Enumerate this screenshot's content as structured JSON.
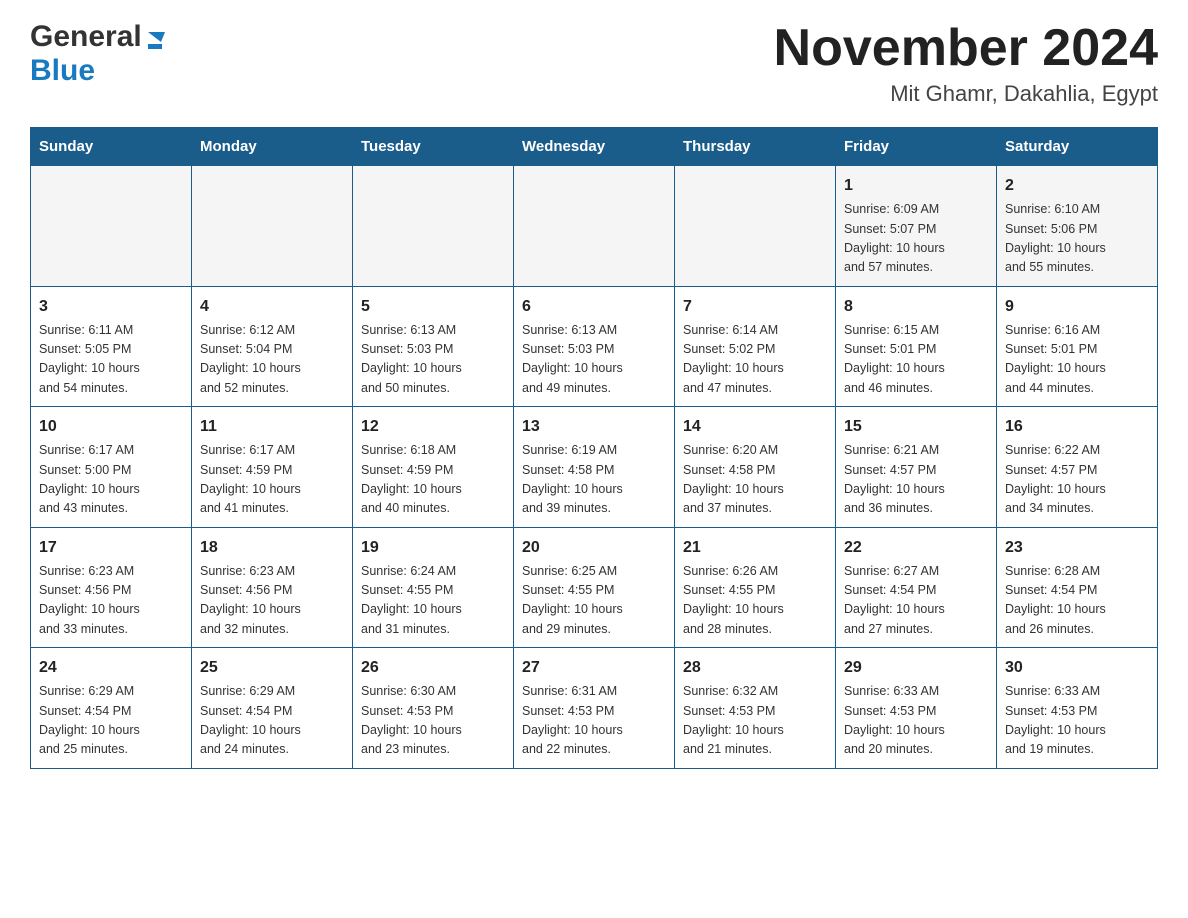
{
  "header": {
    "logo": {
      "general": "General",
      "blue": "Blue",
      "triangle_color": "#1a7abf"
    },
    "title": "November 2024",
    "location": "Mit Ghamr, Dakahlia, Egypt"
  },
  "calendar": {
    "days_of_week": [
      "Sunday",
      "Monday",
      "Tuesday",
      "Wednesday",
      "Thursday",
      "Friday",
      "Saturday"
    ],
    "weeks": [
      {
        "days": [
          {
            "day": "",
            "info": ""
          },
          {
            "day": "",
            "info": ""
          },
          {
            "day": "",
            "info": ""
          },
          {
            "day": "",
            "info": ""
          },
          {
            "day": "",
            "info": ""
          },
          {
            "day": "1",
            "info": "Sunrise: 6:09 AM\nSunset: 5:07 PM\nDaylight: 10 hours\nand 57 minutes."
          },
          {
            "day": "2",
            "info": "Sunrise: 6:10 AM\nSunset: 5:06 PM\nDaylight: 10 hours\nand 55 minutes."
          }
        ]
      },
      {
        "days": [
          {
            "day": "3",
            "info": "Sunrise: 6:11 AM\nSunset: 5:05 PM\nDaylight: 10 hours\nand 54 minutes."
          },
          {
            "day": "4",
            "info": "Sunrise: 6:12 AM\nSunset: 5:04 PM\nDaylight: 10 hours\nand 52 minutes."
          },
          {
            "day": "5",
            "info": "Sunrise: 6:13 AM\nSunset: 5:03 PM\nDaylight: 10 hours\nand 50 minutes."
          },
          {
            "day": "6",
            "info": "Sunrise: 6:13 AM\nSunset: 5:03 PM\nDaylight: 10 hours\nand 49 minutes."
          },
          {
            "day": "7",
            "info": "Sunrise: 6:14 AM\nSunset: 5:02 PM\nDaylight: 10 hours\nand 47 minutes."
          },
          {
            "day": "8",
            "info": "Sunrise: 6:15 AM\nSunset: 5:01 PM\nDaylight: 10 hours\nand 46 minutes."
          },
          {
            "day": "9",
            "info": "Sunrise: 6:16 AM\nSunset: 5:01 PM\nDaylight: 10 hours\nand 44 minutes."
          }
        ]
      },
      {
        "days": [
          {
            "day": "10",
            "info": "Sunrise: 6:17 AM\nSunset: 5:00 PM\nDaylight: 10 hours\nand 43 minutes."
          },
          {
            "day": "11",
            "info": "Sunrise: 6:17 AM\nSunset: 4:59 PM\nDaylight: 10 hours\nand 41 minutes."
          },
          {
            "day": "12",
            "info": "Sunrise: 6:18 AM\nSunset: 4:59 PM\nDaylight: 10 hours\nand 40 minutes."
          },
          {
            "day": "13",
            "info": "Sunrise: 6:19 AM\nSunset: 4:58 PM\nDaylight: 10 hours\nand 39 minutes."
          },
          {
            "day": "14",
            "info": "Sunrise: 6:20 AM\nSunset: 4:58 PM\nDaylight: 10 hours\nand 37 minutes."
          },
          {
            "day": "15",
            "info": "Sunrise: 6:21 AM\nSunset: 4:57 PM\nDaylight: 10 hours\nand 36 minutes."
          },
          {
            "day": "16",
            "info": "Sunrise: 6:22 AM\nSunset: 4:57 PM\nDaylight: 10 hours\nand 34 minutes."
          }
        ]
      },
      {
        "days": [
          {
            "day": "17",
            "info": "Sunrise: 6:23 AM\nSunset: 4:56 PM\nDaylight: 10 hours\nand 33 minutes."
          },
          {
            "day": "18",
            "info": "Sunrise: 6:23 AM\nSunset: 4:56 PM\nDaylight: 10 hours\nand 32 minutes."
          },
          {
            "day": "19",
            "info": "Sunrise: 6:24 AM\nSunset: 4:55 PM\nDaylight: 10 hours\nand 31 minutes."
          },
          {
            "day": "20",
            "info": "Sunrise: 6:25 AM\nSunset: 4:55 PM\nDaylight: 10 hours\nand 29 minutes."
          },
          {
            "day": "21",
            "info": "Sunrise: 6:26 AM\nSunset: 4:55 PM\nDaylight: 10 hours\nand 28 minutes."
          },
          {
            "day": "22",
            "info": "Sunrise: 6:27 AM\nSunset: 4:54 PM\nDaylight: 10 hours\nand 27 minutes."
          },
          {
            "day": "23",
            "info": "Sunrise: 6:28 AM\nSunset: 4:54 PM\nDaylight: 10 hours\nand 26 minutes."
          }
        ]
      },
      {
        "days": [
          {
            "day": "24",
            "info": "Sunrise: 6:29 AM\nSunset: 4:54 PM\nDaylight: 10 hours\nand 25 minutes."
          },
          {
            "day": "25",
            "info": "Sunrise: 6:29 AM\nSunset: 4:54 PM\nDaylight: 10 hours\nand 24 minutes."
          },
          {
            "day": "26",
            "info": "Sunrise: 6:30 AM\nSunset: 4:53 PM\nDaylight: 10 hours\nand 23 minutes."
          },
          {
            "day": "27",
            "info": "Sunrise: 6:31 AM\nSunset: 4:53 PM\nDaylight: 10 hours\nand 22 minutes."
          },
          {
            "day": "28",
            "info": "Sunrise: 6:32 AM\nSunset: 4:53 PM\nDaylight: 10 hours\nand 21 minutes."
          },
          {
            "day": "29",
            "info": "Sunrise: 6:33 AM\nSunset: 4:53 PM\nDaylight: 10 hours\nand 20 minutes."
          },
          {
            "day": "30",
            "info": "Sunrise: 6:33 AM\nSunset: 4:53 PM\nDaylight: 10 hours\nand 19 minutes."
          }
        ]
      }
    ]
  }
}
